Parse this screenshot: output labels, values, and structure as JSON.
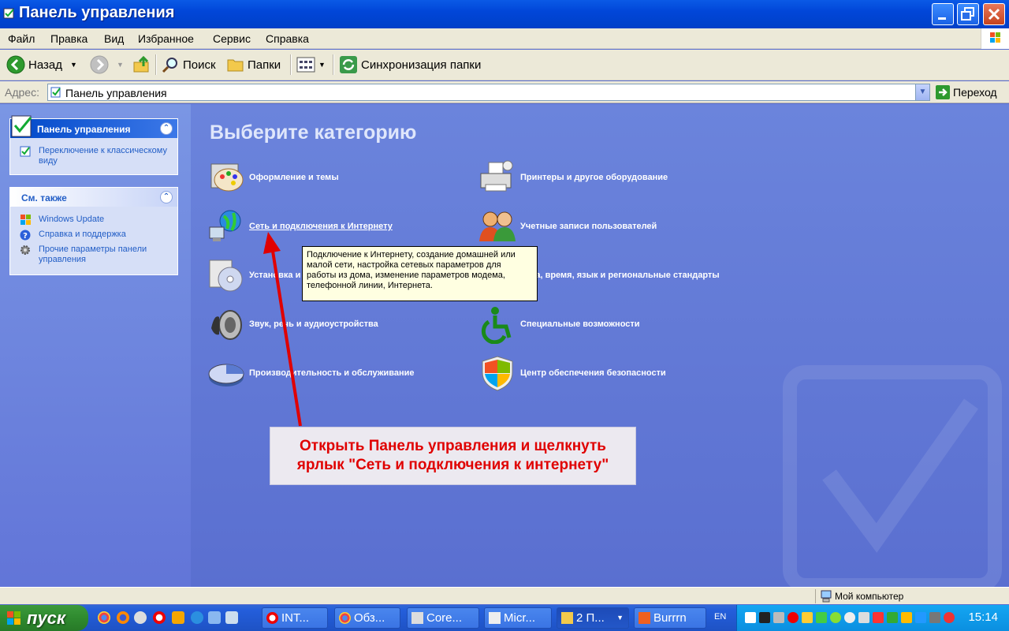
{
  "window": {
    "title": "Панель управления"
  },
  "menu": [
    "Файл",
    "Правка",
    "Вид",
    "Избранное",
    "Сервис",
    "Справка"
  ],
  "toolbar": {
    "back": "Назад",
    "search": "Поиск",
    "folders": "Папки",
    "sync": "Синхронизация папки"
  },
  "address": {
    "label": "Адрес:",
    "value": "Панель управления",
    "go": "Переход"
  },
  "sidebar": {
    "panel_title": "Панель управления",
    "switch_link": "Переключение к классическому виду",
    "see_also_title": "См. также",
    "see_also": [
      "Windows Update",
      "Справка и поддержка",
      "Прочие параметры панели управления"
    ]
  },
  "main": {
    "heading": "Выберите категорию",
    "categories_left": [
      "Оформление и темы",
      "Сеть и подключения к Интернету",
      "Установка и удаление программ",
      "Звук, речь и аудиоустройства",
      "Производительность и обслуживание"
    ],
    "categories_right": [
      "Принтеры и другое оборудование",
      "Учетные записи пользователей",
      "Дата, время, язык и региональные стандарты",
      "Специальные возможности",
      "Центр обеспечения безопасности"
    ],
    "tooltip": "Подключение к Интернету, создание домашней или малой сети, настройка сетевых параметров для работы из дома, изменение параметров модема, телефонной линии, Интернета."
  },
  "callout": {
    "line1": "Открыть Панель управления и щелкнуть",
    "line2": "ярлык \"Сеть и подключения к интернету\""
  },
  "statusbar": {
    "text": "Мой компьютер"
  },
  "taskbar": {
    "start": "пуск",
    "tasks": [
      "INT...",
      "Обз...",
      "Core...",
      "Micr...",
      "2 П...",
      "Burrrn"
    ],
    "language": "EN",
    "clock": "15:14"
  },
  "colors": {
    "titlebar": "#0146d8",
    "content_bg": "#5a6fd0",
    "callout_text": "#e00000",
    "arrow": "#e00000"
  }
}
